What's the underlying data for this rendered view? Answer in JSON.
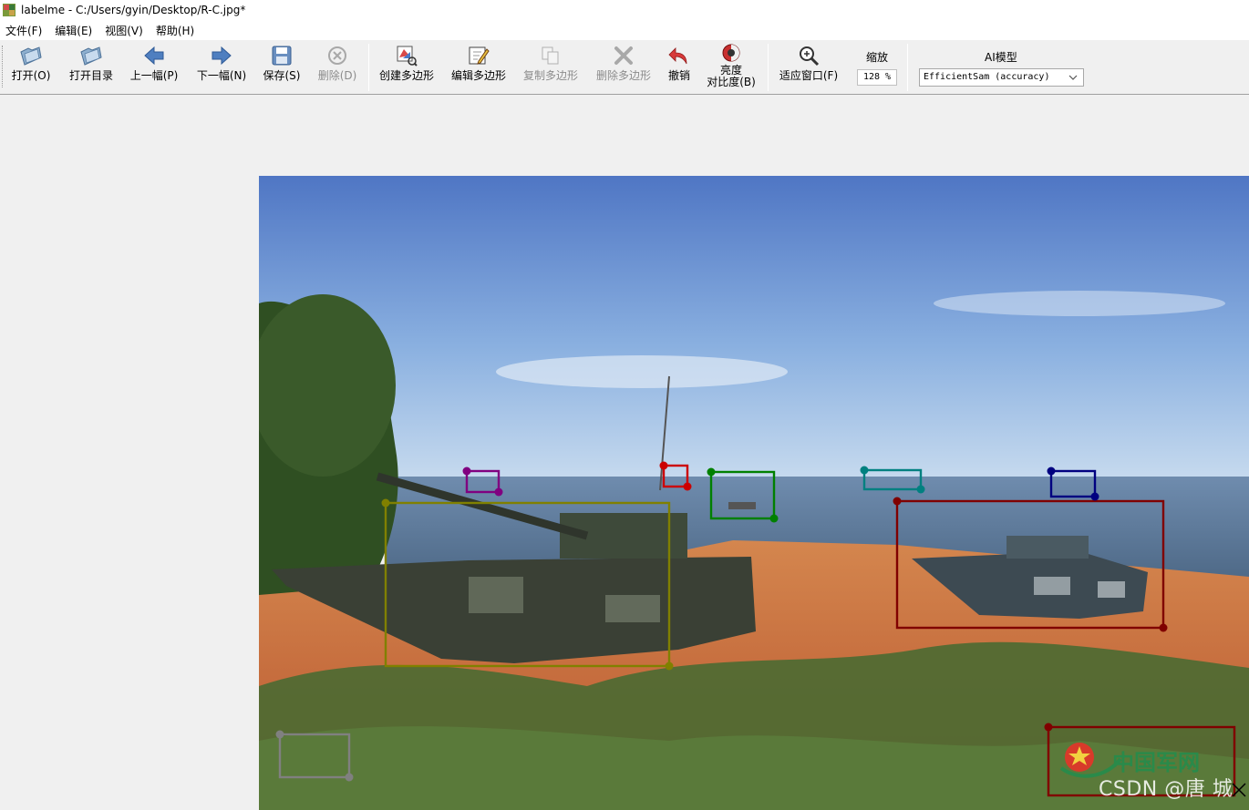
{
  "window": {
    "title": "labelme - C:/Users/gyin/Desktop/R-C.jpg*"
  },
  "menu": {
    "items": [
      "文件(F)",
      "编辑(E)",
      "视图(V)",
      "帮助(H)"
    ]
  },
  "toolbar": {
    "open_label": "打开(O)",
    "open_dir_label": "打开目录",
    "prev_label": "上一幅(P)",
    "next_label": "下一幅(N)",
    "save_label": "保存(S)",
    "delete_file_label": "删除(D)",
    "create_poly_label": "创建多边形",
    "edit_poly_label": "编辑多边形",
    "copy_poly_label": "复制多边形",
    "delete_poly_label": "删除多边形",
    "undo_label": "撤销",
    "brightness_label_1": "亮度",
    "brightness_label_2": "对比度(B)",
    "fit_window_label": "适应窗口(F)",
    "zoom_label": "缩放",
    "zoom_value": "128 %",
    "ai_label": "AI模型",
    "ai_model_value": "EfficientSam (accuracy)"
  },
  "watermark": {
    "csdn_text": "CSDN @唐 城",
    "logo_text": "中国军网"
  },
  "annotations": {
    "colors": [
      "#800080",
      "#cc0000",
      "#008000",
      "#008080",
      "#000080",
      "#808000",
      "#800000",
      "#808080"
    ]
  }
}
